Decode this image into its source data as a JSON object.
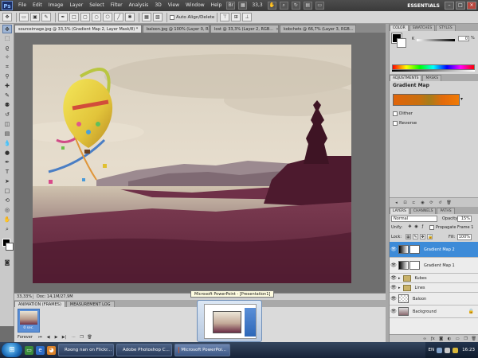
{
  "menubar": {
    "logo": "Ps",
    "items": [
      "File",
      "Edit",
      "Image",
      "Layer",
      "Select",
      "Filter",
      "Analysis",
      "3D",
      "View",
      "Window",
      "Help"
    ],
    "zoom": "33,3",
    "workspace": "ESSENTIALS"
  },
  "options": {
    "auto_align": "Auto Align/Delete"
  },
  "tabs": [
    {
      "label": "sourceimage.jpg @ 33,3% (Gradient Map 2, Layer Mask/8) *"
    },
    {
      "label": "baloon.jpg @ 100% (Layer 0, RGB/8)"
    },
    {
      "label": "lost @ 33,3% (Layer 2, RGB..."
    },
    {
      "label": "kobchets @ 66,7% (Layer 3, RGB..."
    }
  ],
  "status": {
    "zoom": "33,33%",
    "doc": "Doc: 14,1M/27,9M"
  },
  "animation": {
    "tabs": [
      "ANIMATION (FRAMES)",
      "MEASUREMENT LOG"
    ],
    "frame_delay": "0 sec.",
    "loop": "Forever"
  },
  "color_panel": {
    "tabs": [
      "COLOR",
      "SWATCHES",
      "STYLES"
    ],
    "channel": "K",
    "value": "0",
    "unit": "%"
  },
  "adjustments": {
    "tabs": [
      "ADJUSTMENTS",
      "MASKS"
    ],
    "title": "Gradient Map",
    "dither_label": "Dither",
    "reverse_label": "Reverse"
  },
  "layers_panel": {
    "tabs": [
      "LAYERS",
      "CHANNELS",
      "PATHS"
    ],
    "blend_mode": "Normal",
    "opacity_label": "Opacity:",
    "opacity": "15%",
    "unify_label": "Unify:",
    "propagate_label": "Propagate Frame 1",
    "lock_label": "Lock:",
    "fill_label": "Fill:",
    "fill": "100%",
    "layers": [
      {
        "name": "Gradient Map 2",
        "kind": "adjustment",
        "selected": true
      },
      {
        "name": "Gradient Map 1",
        "kind": "adjustment",
        "selected": false
      },
      {
        "name": "Kubes",
        "kind": "folder",
        "selected": false
      },
      {
        "name": "Lines",
        "kind": "folder",
        "selected": false
      },
      {
        "name": "Baloon",
        "kind": "image",
        "selected": false
      },
      {
        "name": "Background",
        "kind": "image",
        "selected": false
      }
    ]
  },
  "taskbar": {
    "tasks": [
      {
        "label": "Roong nan on Flickr..."
      },
      {
        "label": "Adobe Photoshop C..."
      },
      {
        "label": "Microsoft PowerPoi..."
      }
    ],
    "lang": "EN",
    "clock": "16:23"
  },
  "popup": {
    "tooltip": "Microsoft PowerPoint - [Presentation1]"
  },
  "colors": {
    "accent": "#3d8bd8",
    "gradient_start": "#e0640a",
    "gradient_end": "#f07a05"
  }
}
